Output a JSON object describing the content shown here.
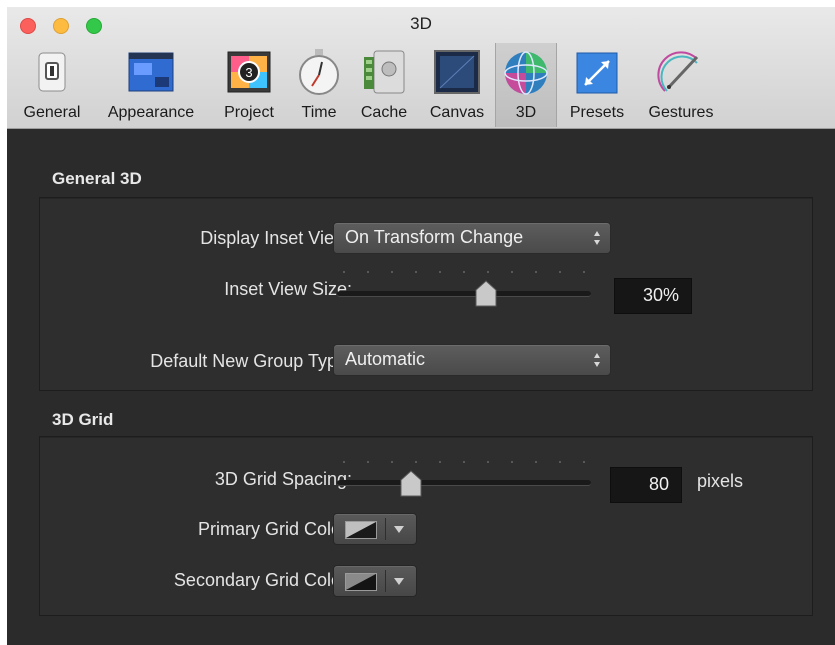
{
  "window": {
    "title": "3D"
  },
  "toolbar": {
    "items": [
      {
        "label": "General",
        "icon": "switch-icon"
      },
      {
        "label": "Appearance",
        "icon": "window-layout-icon"
      },
      {
        "label": "Project",
        "icon": "clapper-icon"
      },
      {
        "label": "Time",
        "icon": "stopwatch-icon"
      },
      {
        "label": "Cache",
        "icon": "storage-icon"
      },
      {
        "label": "Canvas",
        "icon": "canvas-icon"
      },
      {
        "label": "3D",
        "icon": "sphere-icon",
        "selected": true
      },
      {
        "label": "Presets",
        "icon": "presets-icon"
      },
      {
        "label": "Gestures",
        "icon": "pen-icon"
      }
    ]
  },
  "general3d": {
    "heading": "General 3D",
    "display_inset_label": "Display Inset View:",
    "display_inset_value": "On Transform Change",
    "inset_size_label": "Inset View Size:",
    "inset_size_value": "30%",
    "inset_size_slider_fraction": 0.6,
    "group_type_label": "Default New Group Type:",
    "group_type_value": "Automatic"
  },
  "grid3d": {
    "heading": "3D Grid",
    "spacing_label": "3D Grid Spacing:",
    "spacing_value": "80",
    "spacing_unit": "pixels",
    "spacing_slider_fraction": 0.29,
    "primary_color_label": "Primary Grid Color:",
    "secondary_color_label": "Secondary Grid Color:"
  },
  "colors": {
    "traffic_close": "#fc605c",
    "traffic_minimize": "#fdbc40",
    "traffic_zoom": "#34c84a",
    "panel_bg": "#2b2b2b"
  }
}
